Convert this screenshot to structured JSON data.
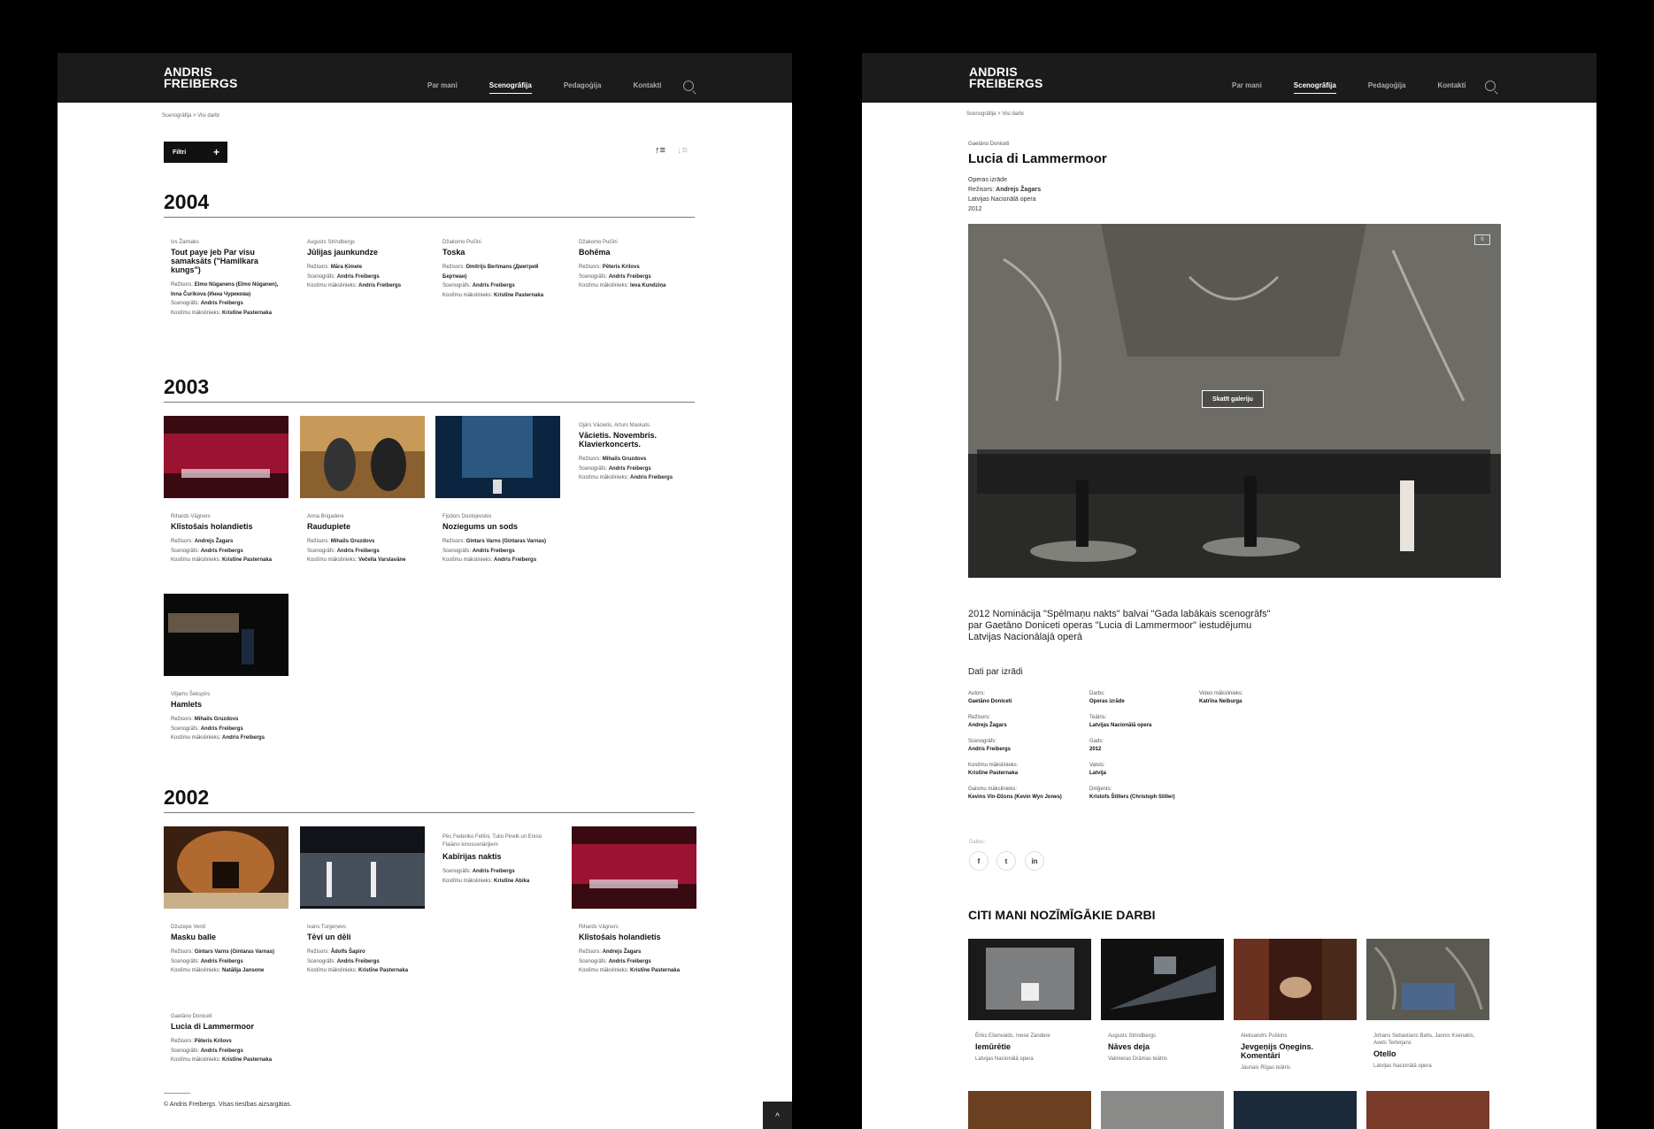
{
  "site": {
    "logo_line1": "ANDRIS",
    "logo_line2": "FREIBERGS",
    "nav": [
      "Par mani",
      "Scenogrāfija",
      "Pedagoģija",
      "Kontakti"
    ],
    "search_icon": "search-icon"
  },
  "list_page": {
    "breadcrumb": "Scenogrāfija > Visi darbi",
    "filter_label": "Filtri",
    "sort_asc_icon": "↑≡",
    "sort_desc_icon": "↓≡",
    "years": [
      {
        "year": "2004",
        "works": [
          {
            "author": "Ivs Žamiaks",
            "title": "Tout paye jeb Par visu samaksāts (\"Hamilkara kungs\")",
            "credits": [
              [
                "Režisors:",
                "Elmo Nüganens (Elmo Nüganen), Inna Čurikova (Инна Чурикова)"
              ],
              [
                "Scenogrāfs:",
                "Andris Freibergs"
              ],
              [
                "Kostīmu mākslinieks:",
                "Kristīne Pasternaka"
              ]
            ]
          },
          {
            "author": "Augusts Strindbergs",
            "title": "Jūlijas jaunkundze",
            "credits": [
              [
                "Režisors:",
                "Māra Ķimele"
              ],
              [
                "Scenogrāfs:",
                "Andris Freibergs"
              ],
              [
                "Kostīmu mākslinieks:",
                "Andris Freibergs"
              ]
            ]
          },
          {
            "author": "Džakomo Pučīni",
            "title": "Toska",
            "credits": [
              [
                "Režisors:",
                "Dmitrijs Bertmans (Дмитрий Бертман)"
              ],
              [
                "Scenogrāfs:",
                "Andris Freibergs"
              ],
              [
                "Kostīmu mākslinieks:",
                "Kristīne Pasternaka"
              ]
            ]
          },
          {
            "author": "Džakomo Pučīni",
            "title": "Bohēma",
            "credits": [
              [
                "Režisors:",
                "Pēteris Krilovs"
              ],
              [
                "Scenogrāfs:",
                "Andris Freibergs"
              ],
              [
                "Kostīmu mākslinieks:",
                "Ieva Kundziņa"
              ]
            ]
          }
        ]
      },
      {
        "year": "2003",
        "works": [
          {
            "author": "Rihards Vāgners",
            "title": "Klīstošais holandietis",
            "credits": [
              [
                "Režisors:",
                "Andrejs Žagars"
              ],
              [
                "Scenogrāfs:",
                "Andris Freibergs"
              ],
              [
                "Kostīmu mākslinieks:",
                "Kristīne Pasternaka"
              ]
            ]
          },
          {
            "author": "Anna Brigadere",
            "title": "Raudupiete",
            "credits": [
              [
                "Režisors:",
                "Mihails Gruzdovs"
              ],
              [
                "Scenogrāfs:",
                "Andris Freibergs"
              ],
              [
                "Kostīmu mākslinieks:",
                "Večella Varslavāne"
              ]
            ]
          },
          {
            "author": "Fjodors Dostojevskis",
            "title": "Noziegums un sods",
            "credits": [
              [
                "Režisors:",
                "Gintars Varns (Gintaras Varnas)"
              ],
              [
                "Scenogrāfs:",
                "Andris Freibergs"
              ],
              [
                "Kostīmu mākslinieks:",
                "Andris Freibergs"
              ]
            ]
          },
          {
            "author": "Ojārs Vācietis, Arturs Maskats",
            "title": "Vācietis. Novembris. Klavierkoncerts.",
            "credits": [
              [
                "Režisors:",
                "Mihails Gruzdovs"
              ],
              [
                "Scenogrāfs:",
                "Andris Freibergs"
              ],
              [
                "Kostīmu mākslinieks:",
                "Andris Freibergs"
              ]
            ]
          },
          {
            "author": "Viljams Šekspīrs",
            "title": "Hamlets",
            "credits": [
              [
                "Režisors:",
                "Mihails Gruzdovs"
              ],
              [
                "Scenogrāfs:",
                "Andris Freibergs"
              ],
              [
                "Kostīmu mākslinieks:",
                "Andris Freibergs"
              ]
            ]
          }
        ]
      },
      {
        "year": "2002",
        "works": [
          {
            "author": "Džuzepe Verdi",
            "title": "Masku balle",
            "credits": [
              [
                "Režisors:",
                "Gintars Varns (Gintaras Varnas)"
              ],
              [
                "Scenogrāfs:",
                "Andris Freibergs"
              ],
              [
                "Kostīmu mākslinieks:",
                "Natālija Jansone"
              ]
            ]
          },
          {
            "author": "Ivans Turgeņevs",
            "title": "Tēvi un dēli",
            "credits": [
              [
                "Režisors:",
                "Ādolfs Šapiro"
              ],
              [
                "Scenogrāfs:",
                "Andris Freibergs"
              ],
              [
                "Kostīmu mākslinieks:",
                "Kristīne Pasternaka"
              ]
            ]
          },
          {
            "author": "Pēc Federiko Fellīni, Tulio Pinelli un Ennio Flaiāno kinoscenārijiem",
            "title": "Kabīrijas naktis",
            "credits": [
              [
                "Scenogrāfs:",
                "Andris Freibergs"
              ],
              [
                "Kostīmu mākslinieks:",
                "Kristīne Abika"
              ]
            ]
          },
          {
            "author": "Rihards Vāgners",
            "title": "Klīstošais holandietis",
            "credits": [
              [
                "Režisors:",
                "Andrejs Žagars"
              ],
              [
                "Scenogrāfs:",
                "Andris Freibergs"
              ],
              [
                "Kostīmu mākslinieks:",
                "Kristīne Pasternaka"
              ]
            ]
          },
          {
            "author": "Gaetāno Doniceti",
            "title": "Lucia di Lammermoor",
            "credits": [
              [
                "Režisors:",
                "Pēteris Krilovs"
              ],
              [
                "Scenogrāfs:",
                "Andris Freibergs"
              ],
              [
                "Kostīmu mākslinieks:",
                "Kristīne Pasternaka"
              ]
            ]
          }
        ]
      }
    ],
    "footer": "© Andris Freibergs. Visas tiesības aizsargātas.",
    "scroll_top_icon": "^"
  },
  "detail_page": {
    "breadcrumb": "Scenogrāfija > Visi darbi",
    "author": "Gaetāno Doniceti",
    "title": "Lucia di Lammermoor",
    "meta_type": "Operas izrāde",
    "meta_director_label": "Režisors:",
    "meta_director": "Andrejs Žagars",
    "meta_theatre": "Latvijas Nacionālā opera",
    "meta_year": "2012",
    "gallery_button": "Skatīt galeriju",
    "gallery_count": "6",
    "award": "2012 Nominācija \"Spēlmaņu nakts\" balvai \"Gada labākais scenogrāfs\" par Gaetāno Doniceti operas \"Lucia di Lammermoor\" iestudējumu Latvijas Nacionālajā operā",
    "facts_heading": "Dati par izrādi",
    "facts": [
      {
        "label": "Autors:",
        "value": "Gaetāno Doniceti"
      },
      {
        "label": "Režisors:",
        "value": "Andrejs Žagars"
      },
      {
        "label": "Scenogrāfs:",
        "value": "Andris Freibergs"
      },
      {
        "label": "Kostīmu mākslinieks:",
        "value": "Kristīne Pasternaka"
      },
      {
        "label": "Gaismu mākslinieks:",
        "value": "Kevins Vin-Džons (Kevin Wyn Jones)"
      },
      {
        "label": "Darbs:",
        "value": "Operas izrāde"
      },
      {
        "label": "Teātris:",
        "value": "Latvijas Nacionālā opera"
      },
      {
        "label": "Gads:",
        "value": "2012"
      },
      {
        "label": "Valsts:",
        "value": "Latvija"
      },
      {
        "label": "Diriģents:",
        "value": "Kristofs Štillers (Christoph Stiller)"
      },
      {
        "label": "Video mākslinieks:",
        "value": "Katrīna Neiburga"
      }
    ],
    "share_label": "Dalies:",
    "share_icons": [
      "f",
      "t",
      "in"
    ],
    "others_heading": "CITI MANI NOZĪMĪGĀKIE DARBI",
    "others": [
      {
        "author": "Ēriks Ešenvalds, Inese Zandere",
        "title": "Iemūrētie",
        "venue": "Latvijas Nacionālā opera"
      },
      {
        "author": "Augusts Strindbergs",
        "title": "Nāves deja",
        "venue": "Valmieras Drāmas teātris"
      },
      {
        "author": "Aleksandrs Puškins",
        "title": "Jevgeņijs Oņegins. Komentāri",
        "venue": "Jaunais Rīgas teātris"
      },
      {
        "author": "Johans Sebastians Bahs, Jannis Ksenakis, Avets Terterjans",
        "title": "Otello",
        "venue": "Latvijas Nacionālā opera"
      }
    ]
  }
}
